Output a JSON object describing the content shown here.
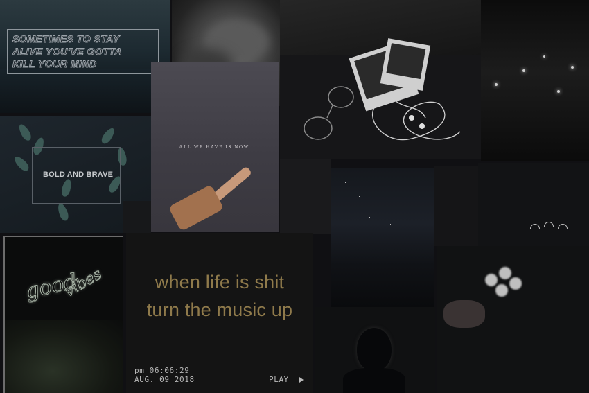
{
  "collage": {
    "sea_quote_lines": [
      "SOMETIMES TO STAY",
      "ALIVE YOU'VE GOTTA",
      "KILL YOUR MIND"
    ],
    "leaves_text": "BOLD AND BRAVE",
    "hand_text": "ALL WE HAVE IS NOW.",
    "neon_line1": "good",
    "neon_line2": "vibes",
    "music_quote_line1": "when life is shit",
    "music_quote_line2": "turn the music up",
    "vhs_time": "pm 06:06:29",
    "vhs_date": "AUG. 09 2018",
    "vhs_play": "PLAY"
  }
}
